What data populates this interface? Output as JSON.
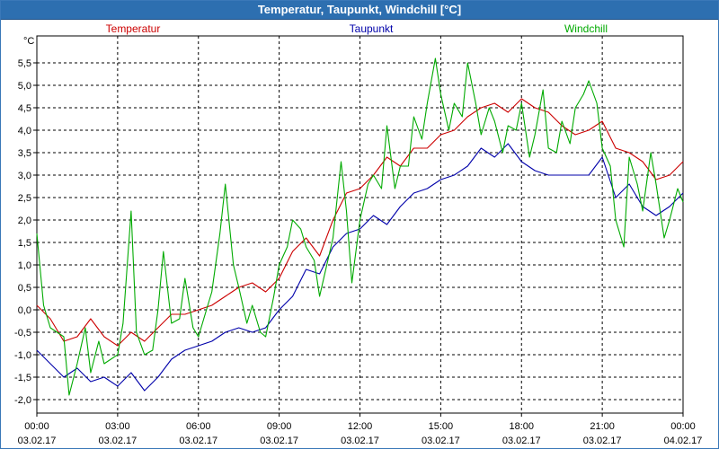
{
  "window": {
    "title": "Temperatur, Taupunkt, Windchill [°C]"
  },
  "chart_data": {
    "type": "line",
    "title": "Temperatur, Taupunkt, Windchill [°C]",
    "ylabel": "°C",
    "xlabel": "",
    "ylim": [
      -2.3,
      6.1
    ],
    "xlim": [
      0,
      24
    ],
    "grid": true,
    "legend_placement": "top",
    "y_ticks": [
      {
        "v": 5.5,
        "label": "5,5"
      },
      {
        "v": 5.0,
        "label": "5,0"
      },
      {
        "v": 4.5,
        "label": "4,5"
      },
      {
        "v": 4.0,
        "label": "4,0"
      },
      {
        "v": 3.5,
        "label": "3,5"
      },
      {
        "v": 3.0,
        "label": "3,0"
      },
      {
        "v": 2.5,
        "label": "2,5"
      },
      {
        "v": 2.0,
        "label": "2,0"
      },
      {
        "v": 1.5,
        "label": "1,5"
      },
      {
        "v": 1.0,
        "label": "1,0"
      },
      {
        "v": 0.5,
        "label": "0,5"
      },
      {
        "v": 0.0,
        "label": "0,0"
      },
      {
        "v": -0.5,
        "label": "-0,5"
      },
      {
        "v": -1.0,
        "label": "-1,0"
      },
      {
        "v": -1.5,
        "label": "-1,5"
      },
      {
        "v": -2.0,
        "label": "-2,0"
      }
    ],
    "x_ticks": [
      {
        "h": 0,
        "time": "00:00",
        "date": "03.02.17"
      },
      {
        "h": 3,
        "time": "03:00",
        "date": "03.02.17"
      },
      {
        "h": 6,
        "time": "06:00",
        "date": "03.02.17"
      },
      {
        "h": 9,
        "time": "09:00",
        "date": "03.02.17"
      },
      {
        "h": 12,
        "time": "12:00",
        "date": "03.02.17"
      },
      {
        "h": 15,
        "time": "15:00",
        "date": "03.02.17"
      },
      {
        "h": 18,
        "time": "18:00",
        "date": "03.02.17"
      },
      {
        "h": 21,
        "time": "21:00",
        "date": "03.02.17"
      },
      {
        "h": 24,
        "time": "00:00",
        "date": "04.02.17"
      }
    ],
    "series": [
      {
        "name": "Temperatur",
        "color": "#cc0000",
        "points": [
          [
            0.0,
            0.1
          ],
          [
            0.5,
            -0.2
          ],
          [
            1.0,
            -0.7
          ],
          [
            1.5,
            -0.6
          ],
          [
            2.0,
            -0.2
          ],
          [
            2.5,
            -0.6
          ],
          [
            3.0,
            -0.8
          ],
          [
            3.5,
            -0.5
          ],
          [
            4.0,
            -0.7
          ],
          [
            4.5,
            -0.4
          ],
          [
            5.0,
            -0.1
          ],
          [
            5.5,
            -0.1
          ],
          [
            6.0,
            0.0
          ],
          [
            6.5,
            0.1
          ],
          [
            7.0,
            0.3
          ],
          [
            7.5,
            0.5
          ],
          [
            8.0,
            0.6
          ],
          [
            8.5,
            0.4
          ],
          [
            9.0,
            0.7
          ],
          [
            9.5,
            1.3
          ],
          [
            10.0,
            1.6
          ],
          [
            10.5,
            1.2
          ],
          [
            11.0,
            2.0
          ],
          [
            11.5,
            2.6
          ],
          [
            12.0,
            2.7
          ],
          [
            12.5,
            3.0
          ],
          [
            13.0,
            3.4
          ],
          [
            13.5,
            3.2
          ],
          [
            14.0,
            3.6
          ],
          [
            14.5,
            3.6
          ],
          [
            15.0,
            3.9
          ],
          [
            15.5,
            4.0
          ],
          [
            16.0,
            4.3
          ],
          [
            16.5,
            4.5
          ],
          [
            17.0,
            4.6
          ],
          [
            17.5,
            4.4
          ],
          [
            18.0,
            4.7
          ],
          [
            18.5,
            4.5
          ],
          [
            19.0,
            4.4
          ],
          [
            19.5,
            4.1
          ],
          [
            20.0,
            3.9
          ],
          [
            20.5,
            4.0
          ],
          [
            21.0,
            4.2
          ],
          [
            21.5,
            3.6
          ],
          [
            22.0,
            3.5
          ],
          [
            22.5,
            3.3
          ],
          [
            23.0,
            2.9
          ],
          [
            23.5,
            3.0
          ],
          [
            24.0,
            3.3
          ]
        ]
      },
      {
        "name": "Taupunkt",
        "color": "#0000aa",
        "points": [
          [
            0.0,
            -0.9
          ],
          [
            0.5,
            -1.2
          ],
          [
            1.0,
            -1.5
          ],
          [
            1.5,
            -1.3
          ],
          [
            2.0,
            -1.6
          ],
          [
            2.5,
            -1.5
          ],
          [
            3.0,
            -1.7
          ],
          [
            3.5,
            -1.4
          ],
          [
            4.0,
            -1.8
          ],
          [
            4.5,
            -1.5
          ],
          [
            5.0,
            -1.1
          ],
          [
            5.5,
            -0.9
          ],
          [
            6.0,
            -0.8
          ],
          [
            6.5,
            -0.7
          ],
          [
            7.0,
            -0.5
          ],
          [
            7.5,
            -0.4
          ],
          [
            8.0,
            -0.5
          ],
          [
            8.5,
            -0.4
          ],
          [
            9.0,
            0.0
          ],
          [
            9.5,
            0.3
          ],
          [
            10.0,
            0.9
          ],
          [
            10.5,
            0.8
          ],
          [
            11.0,
            1.4
          ],
          [
            11.5,
            1.7
          ],
          [
            12.0,
            1.8
          ],
          [
            12.5,
            2.1
          ],
          [
            13.0,
            1.9
          ],
          [
            13.5,
            2.3
          ],
          [
            14.0,
            2.6
          ],
          [
            14.5,
            2.7
          ],
          [
            15.0,
            2.9
          ],
          [
            15.5,
            3.0
          ],
          [
            16.0,
            3.2
          ],
          [
            16.5,
            3.6
          ],
          [
            17.0,
            3.4
          ],
          [
            17.5,
            3.7
          ],
          [
            18.0,
            3.3
          ],
          [
            18.5,
            3.1
          ],
          [
            19.0,
            3.0
          ],
          [
            19.5,
            3.0
          ],
          [
            20.0,
            3.0
          ],
          [
            20.5,
            3.0
          ],
          [
            21.0,
            3.4
          ],
          [
            21.5,
            2.5
          ],
          [
            22.0,
            2.8
          ],
          [
            22.5,
            2.3
          ],
          [
            23.0,
            2.1
          ],
          [
            23.5,
            2.3
          ],
          [
            24.0,
            2.6
          ]
        ]
      },
      {
        "name": "Windchill",
        "color": "#00aa00",
        "points": [
          [
            0.0,
            1.7
          ],
          [
            0.25,
            0.1
          ],
          [
            0.5,
            -0.4
          ],
          [
            1.0,
            -0.6
          ],
          [
            1.2,
            -1.9
          ],
          [
            1.5,
            -1.2
          ],
          [
            1.8,
            -0.4
          ],
          [
            2.0,
            -1.4
          ],
          [
            2.3,
            -0.7
          ],
          [
            2.5,
            -1.2
          ],
          [
            3.0,
            -1.0
          ],
          [
            3.2,
            -0.3
          ],
          [
            3.5,
            2.2
          ],
          [
            3.7,
            -0.5
          ],
          [
            4.0,
            -1.0
          ],
          [
            4.3,
            -0.9
          ],
          [
            4.5,
            0.0
          ],
          [
            4.7,
            1.3
          ],
          [
            5.0,
            -0.3
          ],
          [
            5.3,
            -0.2
          ],
          [
            5.5,
            0.7
          ],
          [
            5.8,
            -0.4
          ],
          [
            6.0,
            -0.6
          ],
          [
            6.3,
            0.0
          ],
          [
            6.5,
            0.4
          ],
          [
            6.8,
            1.7
          ],
          [
            7.0,
            2.8
          ],
          [
            7.3,
            1.0
          ],
          [
            7.5,
            0.5
          ],
          [
            7.8,
            -0.3
          ],
          [
            8.0,
            0.1
          ],
          [
            8.3,
            -0.5
          ],
          [
            8.5,
            -0.6
          ],
          [
            8.8,
            0.3
          ],
          [
            9.0,
            1.0
          ],
          [
            9.3,
            1.4
          ],
          [
            9.5,
            2.0
          ],
          [
            9.8,
            1.8
          ],
          [
            10.0,
            1.4
          ],
          [
            10.3,
            1.1
          ],
          [
            10.5,
            0.3
          ],
          [
            11.0,
            1.6
          ],
          [
            11.3,
            3.3
          ],
          [
            11.5,
            2.2
          ],
          [
            11.7,
            0.6
          ],
          [
            12.0,
            2.0
          ],
          [
            12.3,
            2.8
          ],
          [
            12.5,
            3.0
          ],
          [
            12.8,
            2.7
          ],
          [
            13.0,
            4.1
          ],
          [
            13.3,
            2.7
          ],
          [
            13.5,
            3.2
          ],
          [
            13.8,
            3.2
          ],
          [
            14.0,
            4.3
          ],
          [
            14.3,
            3.8
          ],
          [
            14.5,
            4.6
          ],
          [
            14.8,
            5.6
          ],
          [
            15.0,
            4.8
          ],
          [
            15.3,
            4.0
          ],
          [
            15.5,
            4.6
          ],
          [
            15.8,
            4.3
          ],
          [
            16.0,
            5.5
          ],
          [
            16.3,
            4.6
          ],
          [
            16.5,
            3.9
          ],
          [
            16.8,
            4.5
          ],
          [
            17.0,
            4.2
          ],
          [
            17.3,
            3.5
          ],
          [
            17.5,
            4.1
          ],
          [
            17.8,
            4.0
          ],
          [
            18.0,
            4.6
          ],
          [
            18.3,
            3.4
          ],
          [
            18.5,
            3.9
          ],
          [
            18.8,
            4.9
          ],
          [
            19.0,
            3.6
          ],
          [
            19.3,
            3.5
          ],
          [
            19.5,
            4.2
          ],
          [
            19.8,
            3.7
          ],
          [
            20.0,
            4.5
          ],
          [
            20.3,
            4.8
          ],
          [
            20.5,
            5.1
          ],
          [
            20.8,
            4.6
          ],
          [
            21.0,
            3.6
          ],
          [
            21.3,
            3.2
          ],
          [
            21.5,
            2.0
          ],
          [
            21.8,
            1.4
          ],
          [
            22.0,
            3.4
          ],
          [
            22.3,
            2.8
          ],
          [
            22.5,
            2.2
          ],
          [
            22.8,
            3.5
          ],
          [
            23.0,
            2.8
          ],
          [
            23.3,
            1.6
          ],
          [
            23.5,
            2.0
          ],
          [
            23.8,
            2.7
          ],
          [
            24.0,
            2.4
          ]
        ]
      }
    ]
  }
}
